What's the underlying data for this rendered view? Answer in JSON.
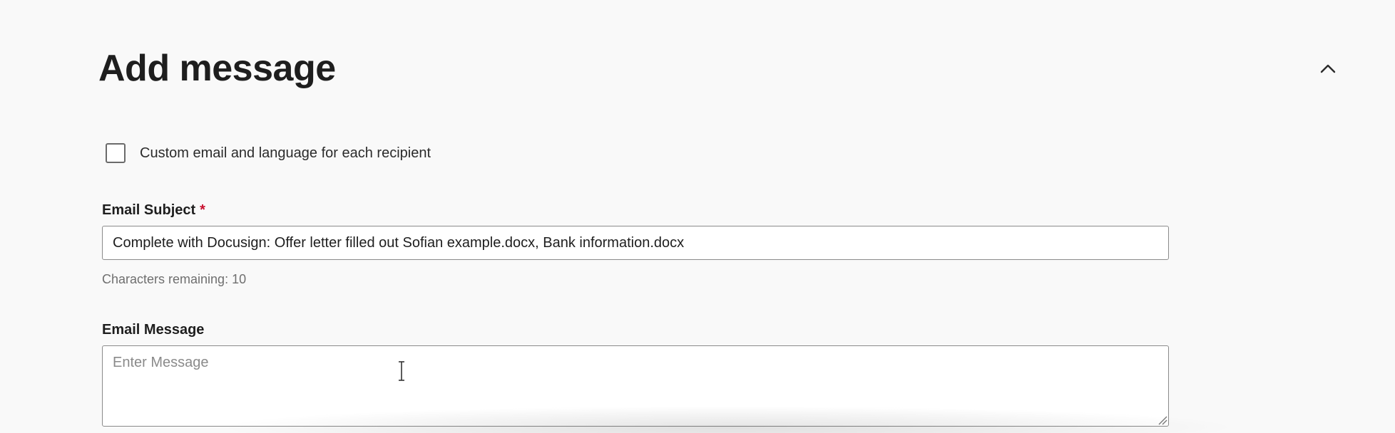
{
  "section": {
    "title": "Add message",
    "collapse_icon": "chevron-up-icon"
  },
  "custom_email": {
    "label": "Custom email and language for each recipient",
    "checked": false
  },
  "email_subject": {
    "label": "Email Subject",
    "required_marker": "*",
    "value": "Complete with Docusign: Offer letter filled out Sofian example.docx, Bank information.docx",
    "helper": "Characters remaining: 10"
  },
  "email_message": {
    "label": "Email Message",
    "placeholder": "Enter Message",
    "value": ""
  },
  "colors": {
    "background": "#f9f9f9",
    "required": "#c8102e",
    "input_border": "#8a8a8a"
  }
}
